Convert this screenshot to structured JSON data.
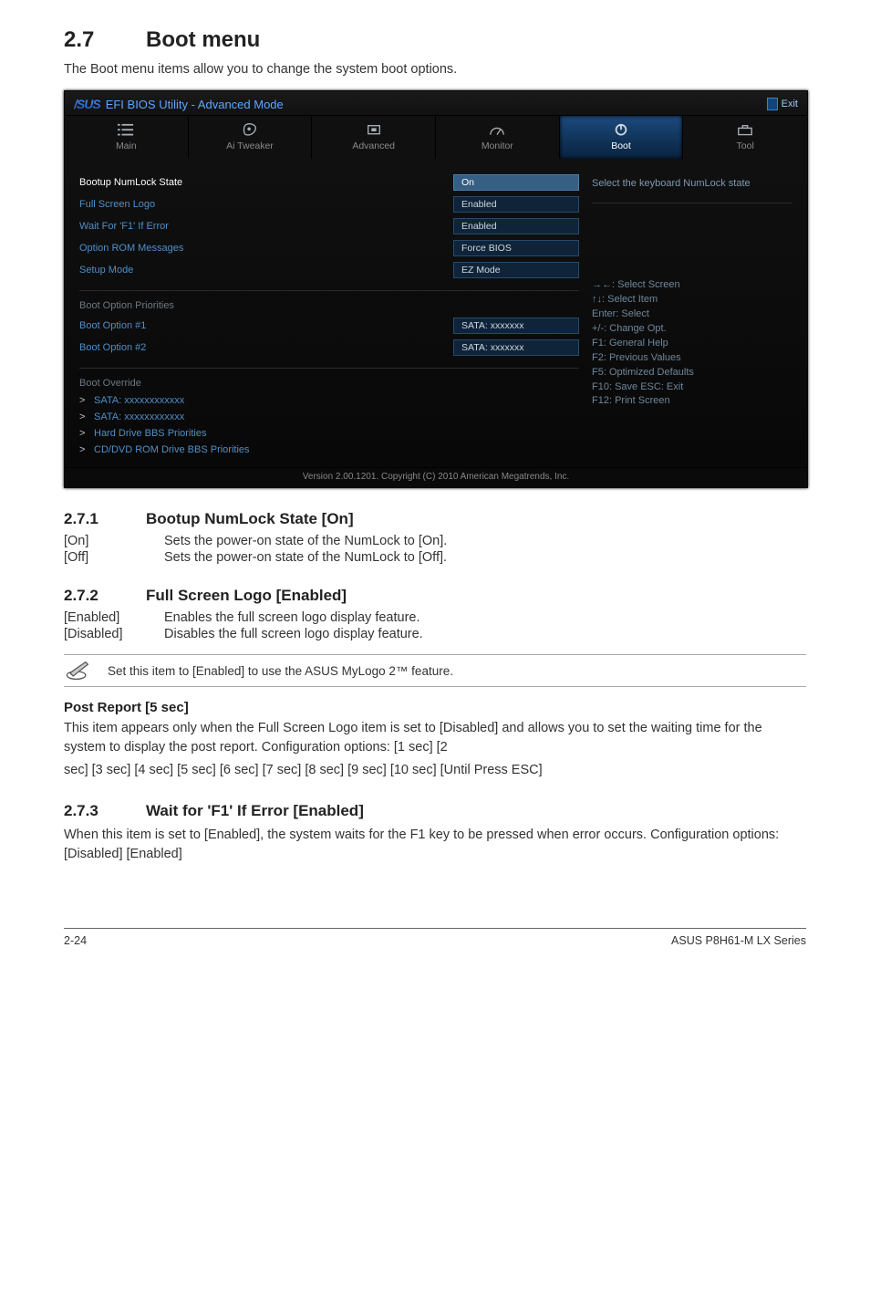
{
  "section": {
    "number": "2.7",
    "title": "Boot menu"
  },
  "lead": "The Boot menu items allow you to change the system boot options.",
  "bios": {
    "brand": "/SUS",
    "title": "EFI BIOS Utility - Advanced Mode",
    "exit": "Exit",
    "tabs": {
      "main": "Main",
      "tweaker": "Ai Tweaker",
      "advanced": "Advanced",
      "monitor": "Monitor",
      "boot": "Boot",
      "tool": "Tool"
    },
    "settings": {
      "numlock": {
        "label": "Bootup NumLock State",
        "value": "On"
      },
      "logo": {
        "label": "Full Screen Logo",
        "value": "Enabled"
      },
      "wait_f1": {
        "label": "Wait For 'F1' If Error",
        "value": "Enabled"
      },
      "oprom": {
        "label": "Option ROM Messages",
        "value": "Force BIOS"
      },
      "setupmode": {
        "label": "Setup Mode",
        "value": "EZ Mode"
      }
    },
    "boot_opts_header": "Boot Option Priorities",
    "boot_opts": {
      "opt1": {
        "label": "Boot Option #1",
        "value": "SATA: xxxxxxx"
      },
      "opt2": {
        "label": "Boot Option #2",
        "value": "SATA: xxxxxxx"
      }
    },
    "override_header": "Boot Override",
    "override": {
      "sata1": "SATA: xxxxxxxxxxxx",
      "sata2": "SATA: xxxxxxxxxxxx",
      "hdd": "Hard Drive BBS Priorities",
      "cd": "CD/DVD ROM Drive BBS Priorities"
    },
    "help_title": "Select the keyboard NumLock state",
    "keys": {
      "k1": "→←: Select Screen",
      "k2": "↑↓: Select Item",
      "k3": "Enter: Select",
      "k4": "+/-: Change Opt.",
      "k5": "F1: General Help",
      "k6": "F2: Previous Values",
      "k7": "F5: Optimized Defaults",
      "k8": "F10: Save   ESC: Exit",
      "k9": "F12: Print Screen"
    },
    "footer": "Version 2.00.1201.  Copyright (C) 2010 American Megatrends, Inc."
  },
  "s271": {
    "num": "2.7.1",
    "title": "Bootup NumLock State [On]",
    "on": "[On]",
    "on_desc": "Sets the power-on state of the NumLock to [On].",
    "off": "[Off]",
    "off_desc": "Sets the power-on state of the NumLock to [Off]."
  },
  "s272": {
    "num": "2.7.2",
    "title": "Full Screen Logo [Enabled]",
    "en": "[Enabled]",
    "en_desc": "Enables the full screen logo display feature.",
    "dis": "[Disabled]",
    "dis_desc": "Disables the full screen logo display feature."
  },
  "note": "Set this item to [Enabled] to use the ASUS MyLogo 2™ feature.",
  "post_report": {
    "heading": "Post Report [5 sec]",
    "p1": "This item appears only when the Full Screen Logo item is set to [Disabled] and allows you to set the waiting time for the system to display the post report. Configuration options: [1 sec] [2",
    "p2": "sec] [3 sec] [4 sec] [5 sec] [6 sec] [7 sec] [8 sec] [9 sec] [10 sec] [Until Press ESC]"
  },
  "s273": {
    "num": "2.7.3",
    "title": "Wait for 'F1' If Error [Enabled]",
    "body": "When this item is set to [Enabled], the system waits for the F1 key to be pressed when error occurs. Configuration options: [Disabled] [Enabled]"
  },
  "footer": {
    "left": "2-24",
    "right": "ASUS P8H61-M LX Series"
  }
}
